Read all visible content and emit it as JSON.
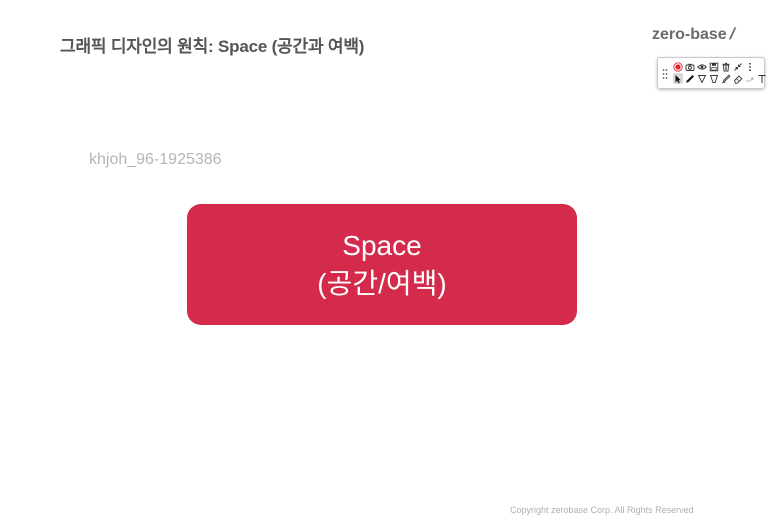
{
  "slide": {
    "title": "그래픽 디자인의 원칙: Space (공간과 여백)",
    "logo_text": "zero-base",
    "logo_mark": "/",
    "watermark_user": "khjoh_96-1925386",
    "box_line1": "Space",
    "box_line2": "(공간/여백)",
    "copyright": "Copyright zerobase Corp. All Rights Reserved"
  },
  "toolbar": {
    "row1": [
      "record-icon",
      "camera-icon",
      "eye-icon",
      "save-icon",
      "trash-icon",
      "collapse-icon",
      "more-icon"
    ],
    "row2": [
      "cursor-icon",
      "pen-icon",
      "highlighter-icon",
      "marker-icon",
      "lasso-icon",
      "eraser-icon",
      "laser-icon",
      "text-icon"
    ]
  },
  "colors": {
    "accent_box": "#d42b4c",
    "title_text": "#555555",
    "watermark_text": "#b5b5b5",
    "record_red": "#e0242f"
  }
}
